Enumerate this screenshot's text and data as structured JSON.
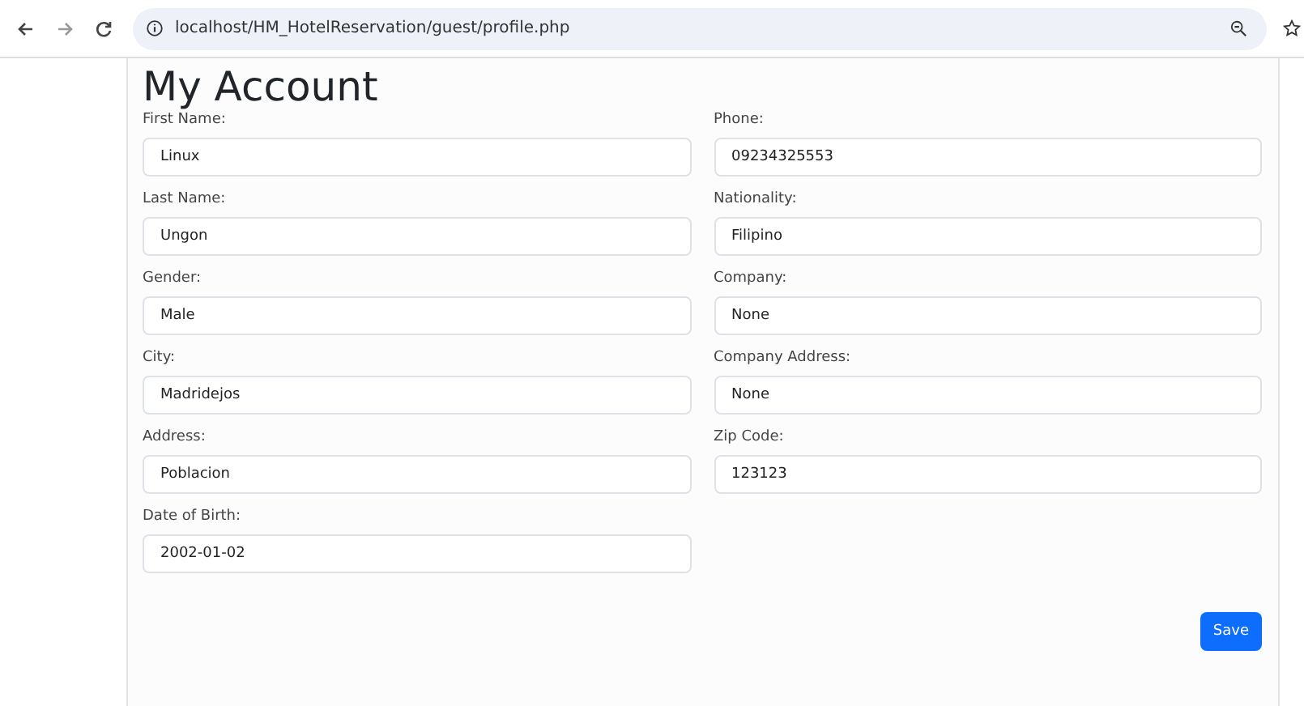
{
  "browser": {
    "url": "localhost/HM_HotelReservation/guest/profile.php"
  },
  "page": {
    "title": "My Account",
    "fields": [
      {
        "label": "First Name:",
        "value": "Linux"
      },
      {
        "label": "Phone:",
        "value": "09234325553"
      },
      {
        "label": "Last Name:",
        "value": "Ungon"
      },
      {
        "label": "Nationality:",
        "value": "Filipino"
      },
      {
        "label": "Gender:",
        "value": "Male"
      },
      {
        "label": "Company:",
        "value": "None"
      },
      {
        "label": "City:",
        "value": "Madridejos"
      },
      {
        "label": "Company Address:",
        "value": "None"
      },
      {
        "label": "Address:",
        "value": "Poblacion"
      },
      {
        "label": "Zip Code:",
        "value": "123123"
      },
      {
        "label": "Date of Birth:",
        "value": "2002-01-02"
      }
    ],
    "save_button": "Save"
  }
}
